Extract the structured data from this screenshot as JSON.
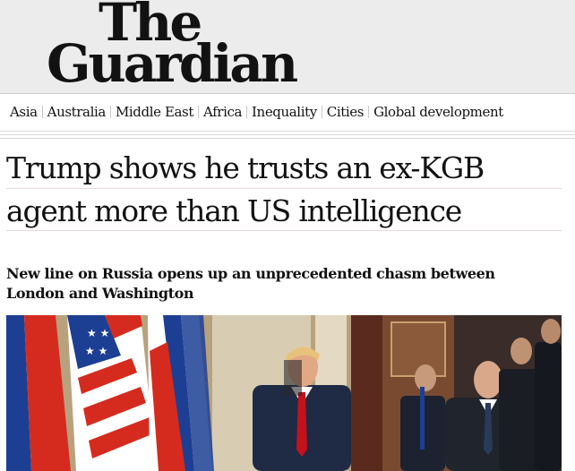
{
  "masthead": {
    "logo_line1": "The",
    "logo_line2": "Guardian"
  },
  "nav": {
    "items": [
      {
        "label": "Asia"
      },
      {
        "label": "Australia"
      },
      {
        "label": "Middle East"
      },
      {
        "label": "Africa"
      },
      {
        "label": "Inequality"
      },
      {
        "label": "Cities"
      },
      {
        "label": "Global development"
      }
    ]
  },
  "article": {
    "headline": "Trump shows he trusts an ex-KGB agent more than US intelligence",
    "standfirst": "New line on Russia opens up an unprecedented chasm between London and Washington"
  },
  "colors": {
    "masthead_bg": "#ececec",
    "text": "#121212",
    "flag_red": "#d52b1e",
    "flag_blue": "#1c3f94"
  }
}
